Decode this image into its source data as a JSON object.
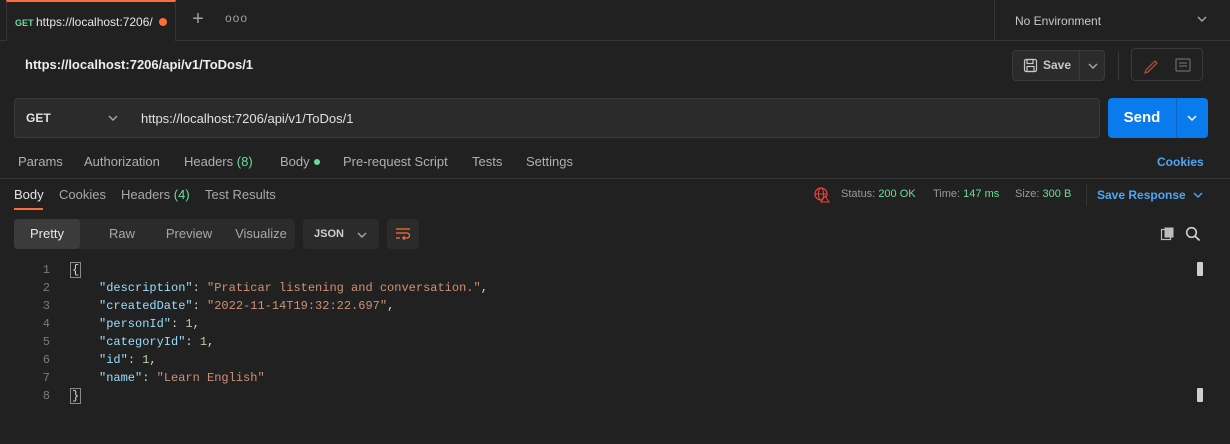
{
  "tab": {
    "method": "GET",
    "url": "https://localhost:7206/",
    "unsaved": true
  },
  "tabbar": {
    "new_tab": "+",
    "more": "ooo"
  },
  "environment": {
    "selected": "No Environment"
  },
  "request": {
    "title": "https://localhost:7206/api/v1/ToDos/1",
    "method": "GET",
    "url": "https://localhost:7206/api/v1/ToDos/1",
    "save_label": "Save",
    "send_label": "Send"
  },
  "request_tabs": [
    {
      "label": "Params"
    },
    {
      "label": "Authorization"
    },
    {
      "label": "Headers",
      "count": "(8)"
    },
    {
      "label": "Body",
      "indicator": true
    },
    {
      "label": "Pre-request Script"
    },
    {
      "label": "Tests"
    },
    {
      "label": "Settings"
    }
  ],
  "cookies_link": "Cookies",
  "response": {
    "tabs": [
      {
        "label": "Body",
        "active": true
      },
      {
        "label": "Cookies"
      },
      {
        "label": "Headers",
        "count": "(4)"
      },
      {
        "label": "Test Results"
      }
    ],
    "status_label": "Status:",
    "status_value": "200 OK",
    "time_label": "Time:",
    "time_value": "147 ms",
    "size_label": "Size:",
    "size_value": "300 B",
    "save_response": "Save Response",
    "views": [
      "Pretty",
      "Raw",
      "Preview",
      "Visualize"
    ],
    "active_view": "Pretty",
    "format": "JSON"
  },
  "body_lines": [
    {
      "n": "1",
      "text": "{"
    },
    {
      "n": "2",
      "key": "\"description\"",
      "value": "\"Praticar listening and conversation.\"",
      "type": "string",
      "comma": ","
    },
    {
      "n": "3",
      "key": "\"createdDate\"",
      "value": "\"2022-11-14T19:32:22.697\"",
      "type": "string",
      "comma": ","
    },
    {
      "n": "4",
      "key": "\"personId\"",
      "value": "1",
      "type": "number",
      "comma": ","
    },
    {
      "n": "5",
      "key": "\"categoryId\"",
      "value": "1",
      "type": "number",
      "comma": ","
    },
    {
      "n": "6",
      "key": "\"id\"",
      "value": "1",
      "type": "number",
      "comma": ","
    },
    {
      "n": "7",
      "key": "\"name\"",
      "value": "\"Learn English\"",
      "type": "string",
      "comma": ""
    },
    {
      "n": "8",
      "text": "}"
    }
  ],
  "colors": {
    "accent": "#ff6c37",
    "send": "#097bed",
    "link": "#4ea6f3",
    "success": "#6bdd9a",
    "json_key": "#9cdcfe",
    "json_string": "#ce9178",
    "json_number": "#b5cea8"
  }
}
